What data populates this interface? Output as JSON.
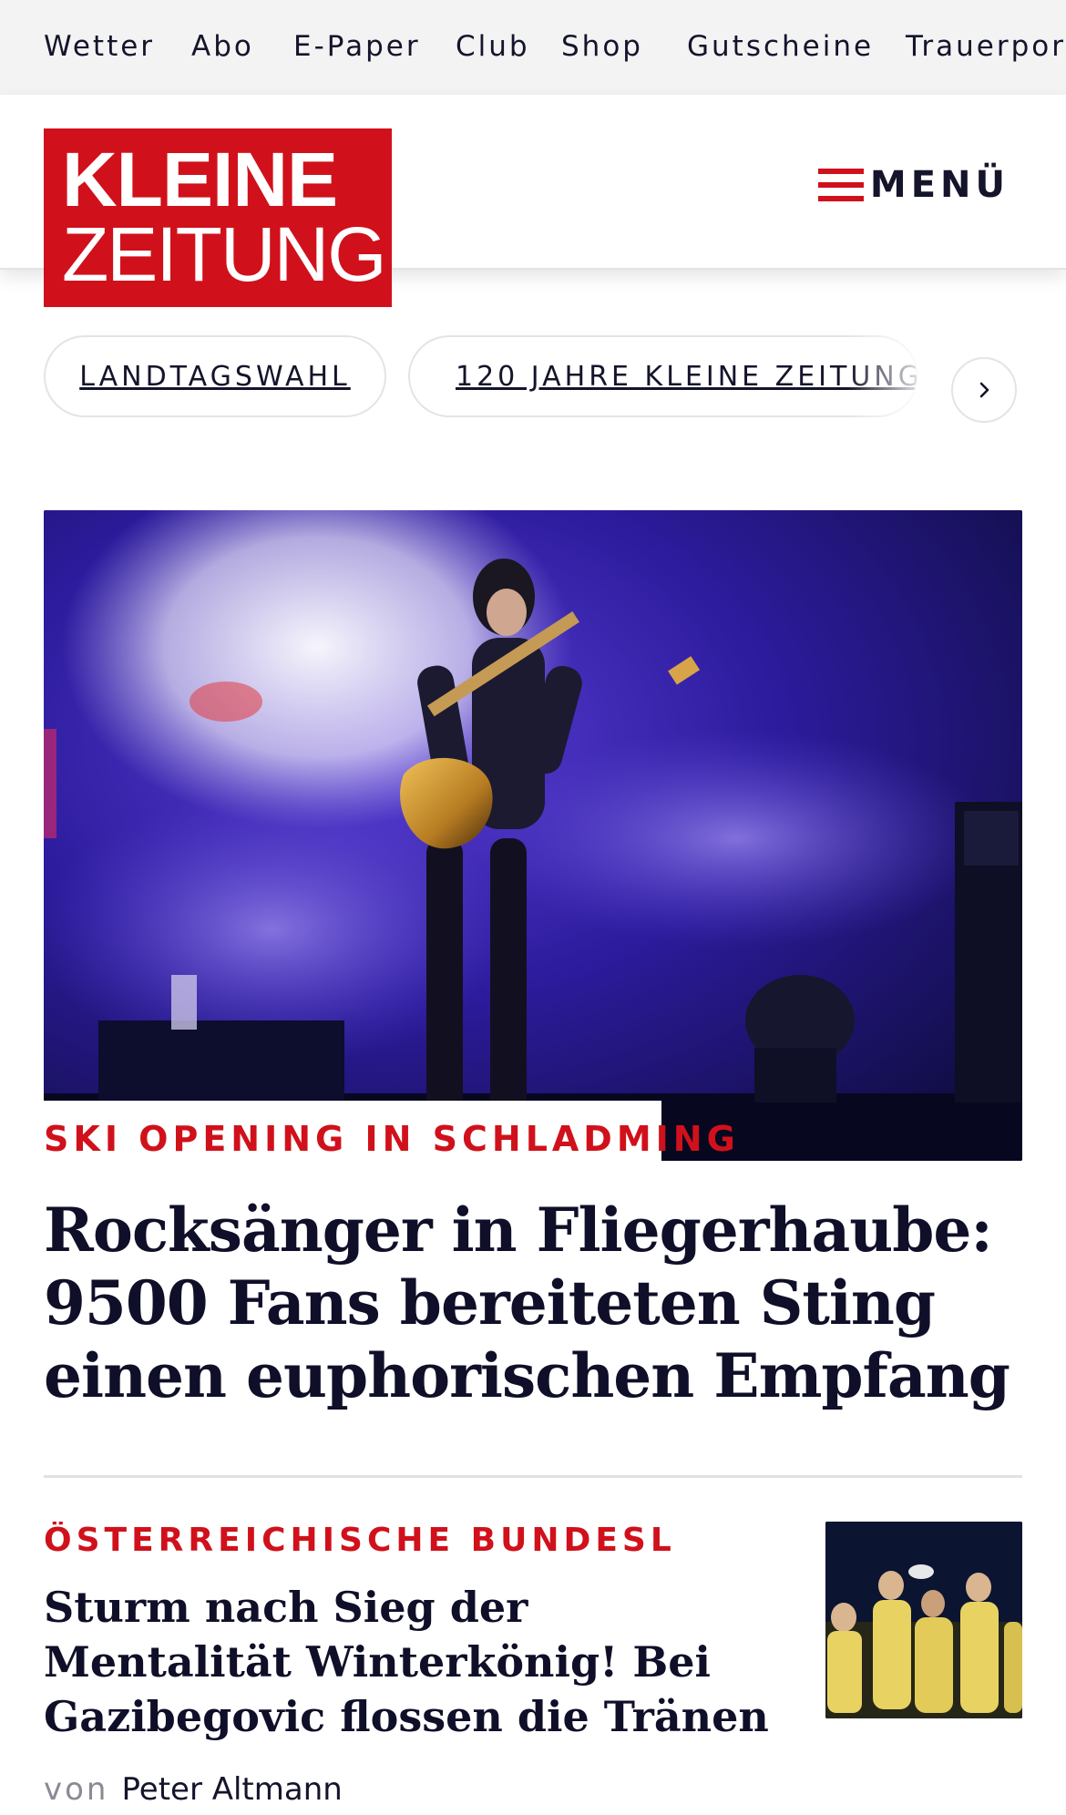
{
  "topnav": {
    "items": [
      "Wetter",
      "Abo",
      "E-Paper",
      "Club",
      "Shop",
      "Gutscheine",
      "Trauerportal"
    ]
  },
  "header": {
    "logo_line1": "KLEINE",
    "logo_line2": "ZEITUNG",
    "menu_label": "MENÜ"
  },
  "topics": {
    "chips": [
      "LANDTAGSWAHL",
      "120 JAHRE KLEINE ZEITUNG"
    ],
    "next_icon": "chevron-right-icon"
  },
  "lead_article": {
    "kicker": "SKI OPENING IN SCHLADMING",
    "headline": "Rocksänger in Fliegerhaube: 9500 Fans bereiteten Sting einen euphorischen Empfang"
  },
  "second_article": {
    "kicker": "ÖSTERREICHISCHE BUNDESLI…",
    "headline": "Sturm nach Sieg der Mentalität Winterkönig! Bei Gazibegovic flossen die Tränen",
    "byline_prefix": "von",
    "author": "Peter Altmann"
  },
  "colors": {
    "brand_red": "#d0111b",
    "text_dark": "#14142b",
    "topbar_bg": "#f3f3f4"
  }
}
